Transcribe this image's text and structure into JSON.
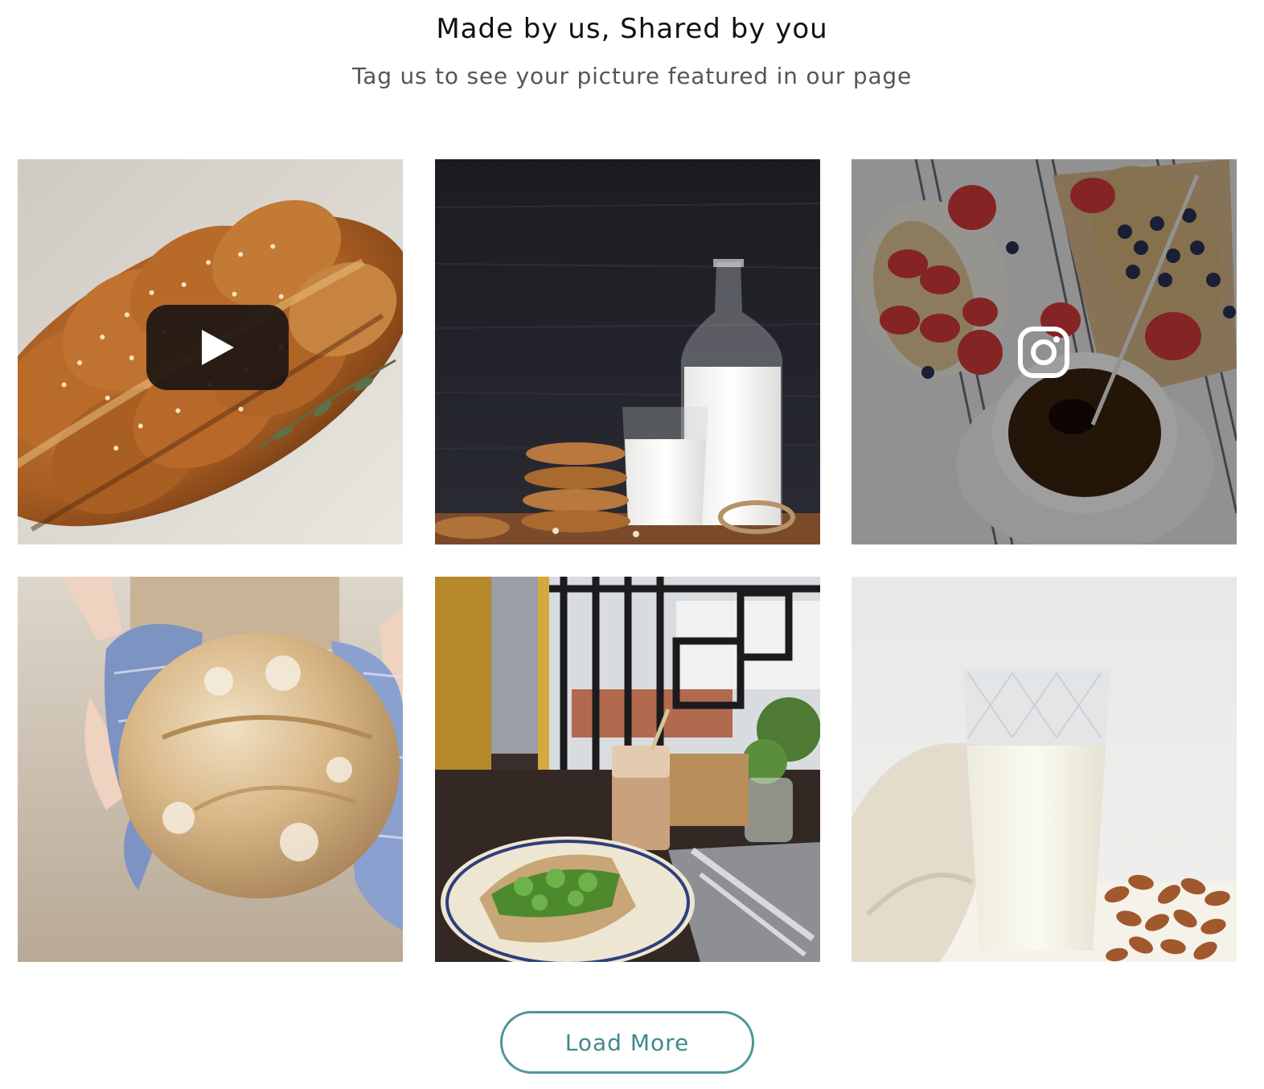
{
  "header": {
    "title": "Made by us, Shared by you",
    "subtitle": "Tag us to see your picture featured in our page"
  },
  "gallery": {
    "items": [
      {
        "subject": "braided sesame challah bread",
        "overlay_icon": "play-icon"
      },
      {
        "subject": "cookies and milk bottle on dark wood",
        "overlay_icon": ""
      },
      {
        "subject": "strawberry toast and coffee",
        "overlay_icon": "instagram-icon"
      },
      {
        "subject": "hands holding rustic bread loaf",
        "overlay_icon": ""
      },
      {
        "subject": "sandwich and iced coffee by window",
        "overlay_icon": ""
      },
      {
        "subject": "glass of milk with almonds",
        "overlay_icon": ""
      }
    ]
  },
  "actions": {
    "load_more_label": "Load More"
  },
  "colors": {
    "accent": "#4e9597",
    "title_text": "#111111",
    "subtitle_text": "#555555"
  }
}
